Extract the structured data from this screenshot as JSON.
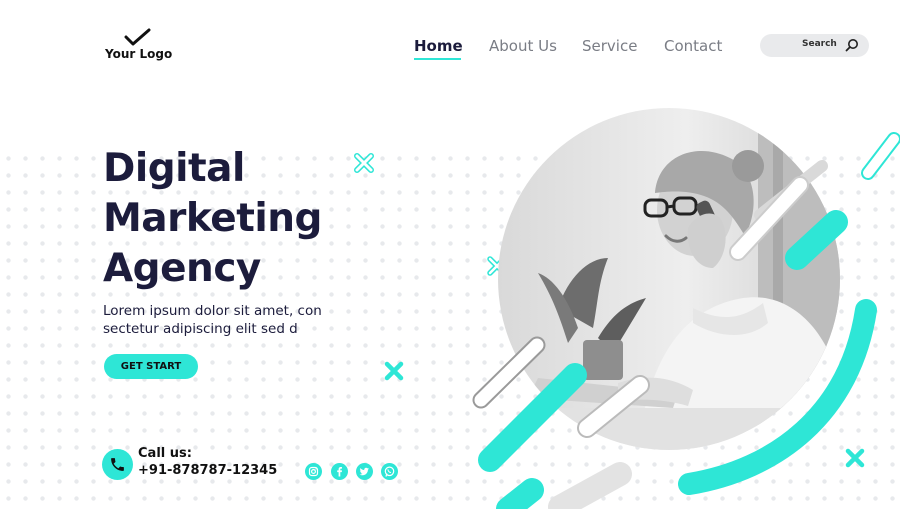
{
  "header": {
    "logo_text": "Your Logo",
    "nav": [
      {
        "label": "Home",
        "active": true
      },
      {
        "label": "About Us",
        "active": false
      },
      {
        "label": "Service",
        "active": false
      },
      {
        "label": "Contact",
        "active": false
      }
    ],
    "search_label": "Search"
  },
  "hero": {
    "headline": [
      "Digital",
      "Marketing",
      "Agency"
    ],
    "description": "Lorem ipsum dolor sit amet, con sectetur adipiscing elit sed d",
    "cta_label": "GET START"
  },
  "contact": {
    "call_label": "Call us:",
    "phone": "+91-878787-12345"
  },
  "social_icons": [
    "instagram-icon",
    "facebook-icon",
    "twitter-icon",
    "whatsapp-icon"
  ],
  "colors": {
    "accent": "#2ee6d6",
    "heading": "#1c1c3c",
    "nav_muted": "#7a7d85",
    "search_bg": "#e9eaec"
  }
}
